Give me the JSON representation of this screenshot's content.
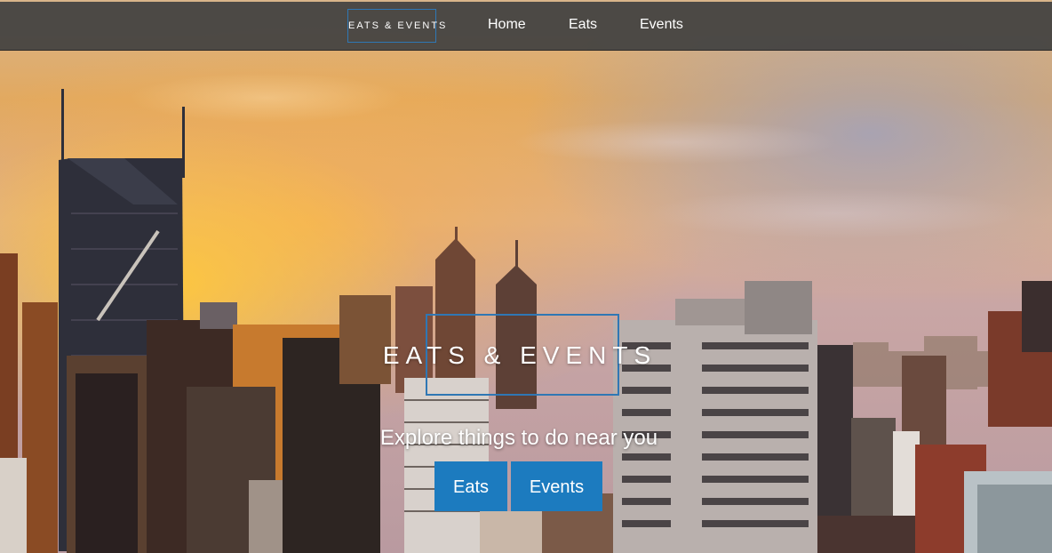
{
  "nav": {
    "brand": "EATS & EVENTS",
    "links": [
      "Home",
      "Eats",
      "Events"
    ]
  },
  "hero": {
    "title": "EATS & EVENTS",
    "tagline": "Explore things to do near you",
    "buttons": [
      "Eats",
      "Events"
    ]
  },
  "colors": {
    "accent": "#1c7bbf",
    "nav_bg": "#404040",
    "brand_border": "#2f77b4"
  }
}
